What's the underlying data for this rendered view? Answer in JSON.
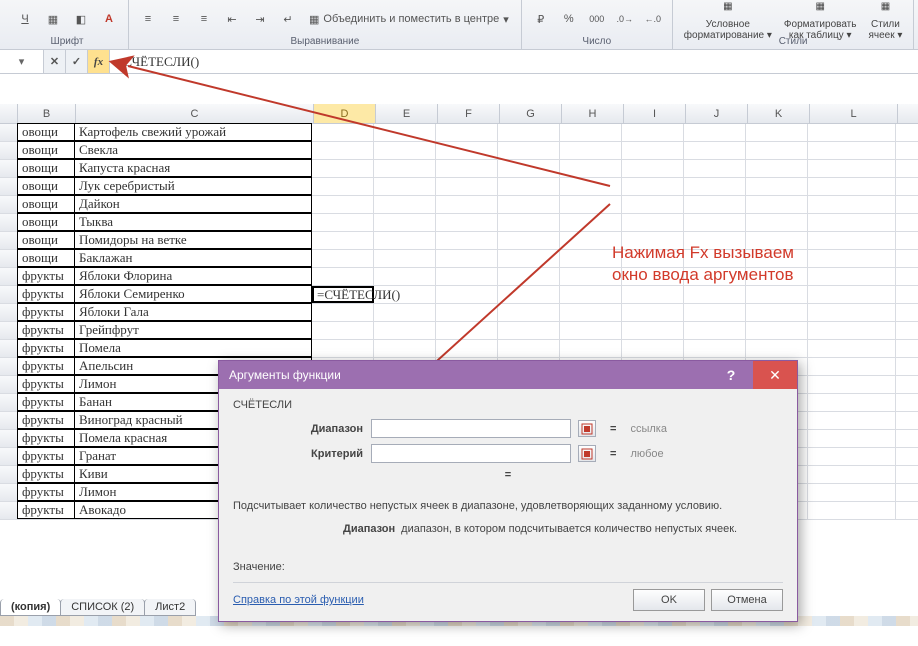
{
  "ribbon": {
    "groups": {
      "font_label": "Шрифт",
      "align_label": "Выравнивание",
      "number_label": "Число",
      "styles_label": "Стили",
      "merge_label": "Объединить и поместить в центре",
      "cond_fmt_line1": "Условное",
      "cond_fmt_line2": "форматирование",
      "fmt_table_line1": "Форматировать",
      "fmt_table_line2": "как таблицу",
      "cell_styles_line1": "Стили",
      "cell_styles_line2": "ячеек"
    }
  },
  "formula_bar": {
    "cancel": "✕",
    "confirm": "✓",
    "fx": "fx",
    "formula": "=СЧЁТЕСЛИ()"
  },
  "columns": [
    "B",
    "C",
    "D",
    "E",
    "F",
    "G",
    "H",
    "I",
    "J",
    "K",
    "L"
  ],
  "table": {
    "rows": [
      {
        "b": "овощи",
        "c": "Картофель свежий урожай"
      },
      {
        "b": "овощи",
        "c": "Свекла"
      },
      {
        "b": "овощи",
        "c": "Капуста красная"
      },
      {
        "b": "овощи",
        "c": "Лук серебристый"
      },
      {
        "b": "овощи",
        "c": "Дайкон"
      },
      {
        "b": "овощи",
        "c": "Тыква"
      },
      {
        "b": "овощи",
        "c": "Помидоры на ветке"
      },
      {
        "b": "овощи",
        "c": "Баклажан"
      },
      {
        "b": "фрукты",
        "c": "Яблоки Флорина"
      },
      {
        "b": "фрукты",
        "c": "Яблоки Семиренко",
        "d": "=СЧЁТЕСЛИ()"
      },
      {
        "b": "фрукты",
        "c": "Яблоки Гала"
      },
      {
        "b": "фрукты",
        "c": "Грейпфрут"
      },
      {
        "b": "фрукты",
        "c": "Помела"
      },
      {
        "b": "фрукты",
        "c": "Апельсин"
      },
      {
        "b": "фрукты",
        "c": "Лимон"
      },
      {
        "b": "фрукты",
        "c": "Банан"
      },
      {
        "b": "фрукты",
        "c": "Виноград  красный"
      },
      {
        "b": "фрукты",
        "c": "Помела красная"
      },
      {
        "b": "фрукты",
        "c": "Гранат"
      },
      {
        "b": "фрукты",
        "c": "Киви"
      },
      {
        "b": "фрукты",
        "c": "Лимон"
      },
      {
        "b": "фрукты",
        "c": "Авокадо"
      }
    ]
  },
  "dialog": {
    "title": "Аргументы функции",
    "fn_name": "СЧЁТЕСЛИ",
    "arg1_label": "Диапазон",
    "arg2_label": "Критерий",
    "arg1_hint": "ссылка",
    "arg2_hint": "любое",
    "desc": "Подсчитывает количество непустых ячеек в диапазоне, удовлетворяющих заданному условию.",
    "param_name": "Диапазон",
    "param_desc": "диапазон, в котором подсчитывается количество непустых ячеек.",
    "value_label": "Значение:",
    "help_link": "Справка по этой функции",
    "ok": "OK",
    "cancel": "Отмена"
  },
  "annotation": {
    "line1": "Нажимая Fx вызываем",
    "line2": "окно ввода аргументов"
  },
  "sheet_tabs": {
    "tab1": "(копия)",
    "tab2": "СПИСОК (2)",
    "tab3": "Лист2"
  }
}
